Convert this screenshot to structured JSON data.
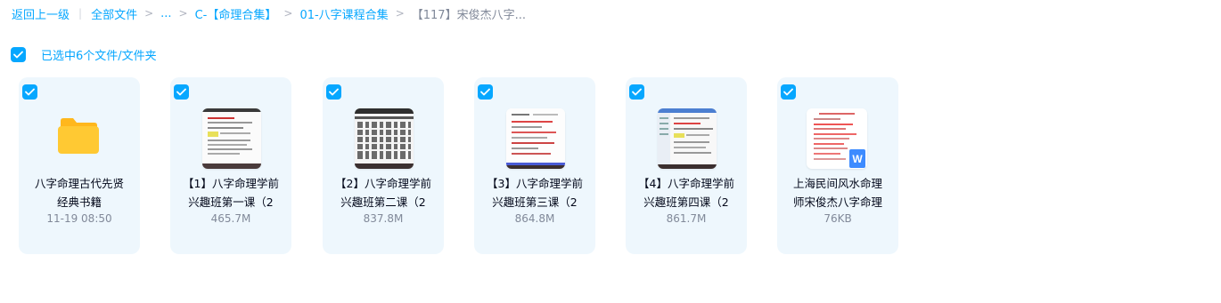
{
  "breadcrumb": {
    "back": "返回上一级",
    "all_files": "全部文件",
    "ellipsis": "...",
    "level1": "C-【命理合集】",
    "level2": "01-八字课程合集",
    "current": "【117】宋俊杰八字..."
  },
  "selection": {
    "text": "已选中6个文件/文件夹"
  },
  "files": [
    {
      "name_line1": "八字命理古代先贤",
      "name_line2": "经典书籍",
      "meta": "11-19 08:50",
      "kind": "folder",
      "icon": "folder-icon"
    },
    {
      "name_line1": "【1】八字命理学前",
      "name_line2": "兴趣班第一课（2",
      "meta": "465.7M",
      "kind": "video",
      "icon": "video-thumbnail"
    },
    {
      "name_line1": "【2】八字命理学前",
      "name_line2": "兴趣班第二课（2",
      "meta": "837.8M",
      "kind": "video",
      "icon": "video-thumbnail"
    },
    {
      "name_line1": "【3】八字命理学前",
      "name_line2": "兴趣班第三课（2",
      "meta": "864.8M",
      "kind": "video",
      "icon": "video-thumbnail"
    },
    {
      "name_line1": "【4】八字命理学前",
      "name_line2": "兴趣班第四课（2",
      "meta": "861.7M",
      "kind": "video",
      "icon": "video-thumbnail"
    },
    {
      "name_line1": "上海民间风水命理",
      "name_line2": "师宋俊杰八字命理",
      "meta": "76KB",
      "kind": "document",
      "icon": "word-doc-icon",
      "badge": "W"
    }
  ],
  "colors": {
    "accent": "#06a7ff",
    "card_bg": "#eef7fd",
    "folder": "#ffc933",
    "word": "#3d8bff"
  }
}
